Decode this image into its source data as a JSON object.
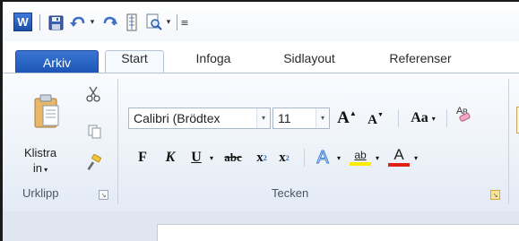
{
  "qat": {
    "app_logo": "W",
    "icons": [
      "save-icon",
      "undo-icon",
      "redo-icon",
      "page-layout-icon",
      "print-preview-icon",
      "customize-toolbar-icon"
    ]
  },
  "tabs": {
    "file": "Arkiv",
    "home": "Start",
    "insert": "Infoga",
    "page_layout": "Sidlayout",
    "references": "Referenser"
  },
  "clipboard": {
    "paste_label_line1": "Klistra",
    "paste_label_line2": "in",
    "group_label": "Urklipp"
  },
  "font": {
    "font_name": "Calibri (Brödtex",
    "font_size": "11",
    "grow_label": "A",
    "shrink_label": "A",
    "change_case_label": "Aa",
    "bold": "F",
    "italic": "K",
    "underline": "U",
    "strikethrough": "abc",
    "subscript_base": "x",
    "subscript_mark": "2",
    "superscript_base": "x",
    "superscript_mark": "2",
    "text_effects": "A",
    "highlight": "ab",
    "font_color": "A",
    "group_label": "Tecken"
  },
  "colors": {
    "file_tab": "#2a66c4",
    "highlight_color": "#ffea00",
    "font_color": "#e0201a",
    "text_effect": "#4a8ad8"
  }
}
